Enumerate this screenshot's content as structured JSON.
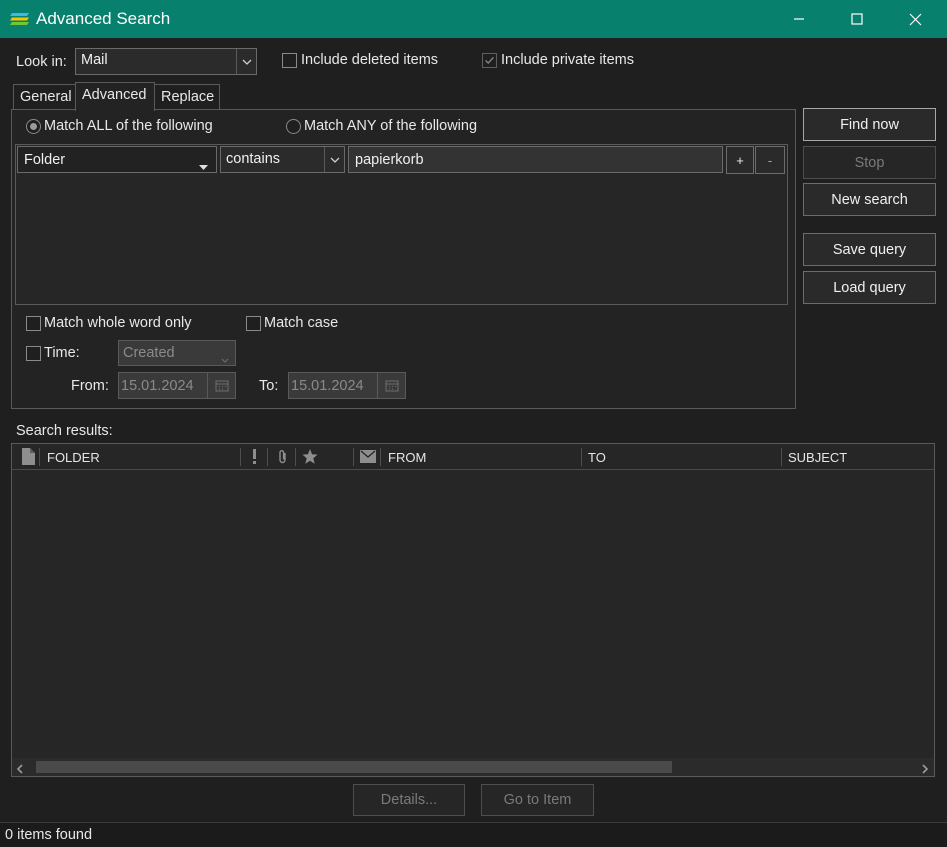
{
  "window": {
    "title": "Advanced Search",
    "buttons": {
      "minimize": "minimize",
      "maximize": "maximize",
      "close": "close"
    }
  },
  "lookin": {
    "label": "Look in:",
    "value": "Mail",
    "include_deleted_label": "Include deleted items",
    "include_deleted_checked": false,
    "include_private_label": "Include private items",
    "include_private_checked": true
  },
  "tabs": [
    {
      "label": "General",
      "active": false
    },
    {
      "label": "Advanced",
      "active": true
    },
    {
      "label": "Replace",
      "active": false
    }
  ],
  "match": {
    "all_label": "Match ALL of the following",
    "any_label": "Match ANY of the following",
    "selected": "all"
  },
  "criteria": [
    {
      "field": "Folder",
      "operator": "contains",
      "value": "papierkorb"
    }
  ],
  "criteria_buttons": {
    "add": "+",
    "remove": "-"
  },
  "options": {
    "whole_word_label": "Match whole word only",
    "whole_word_checked": false,
    "match_case_label": "Match case",
    "match_case_checked": false,
    "time_label": "Time:",
    "time_checked": false,
    "time_field": "Created",
    "from_label": "From:",
    "from_value": "15.01.2024",
    "to_label": "To:",
    "to_value": "15.01.2024"
  },
  "actions": {
    "find_now": "Find now",
    "stop": "Stop",
    "new_search": "New search",
    "save_query": "Save query",
    "load_query": "Load query"
  },
  "results": {
    "label": "Search results:",
    "columns": [
      "FOLDER",
      "FROM",
      "TO",
      "SUBJECT"
    ],
    "rows": []
  },
  "bottom": {
    "details": "Details...",
    "goto": "Go to Item"
  },
  "status": {
    "text": "0 items found"
  },
  "colors": {
    "titlebar": "#07806d",
    "background": "#1f1f1f"
  }
}
